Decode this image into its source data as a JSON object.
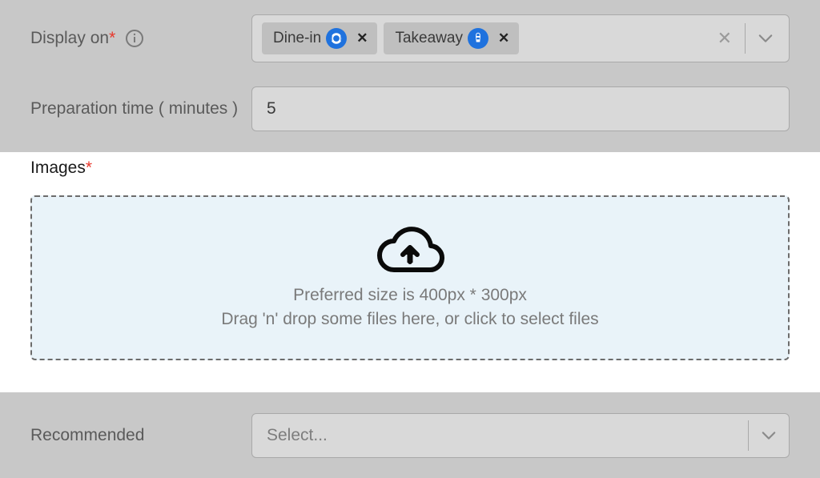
{
  "display_on": {
    "label": "Display on",
    "required_marker": "*",
    "tags": [
      {
        "label": "Dine-in",
        "icon": "dinein"
      },
      {
        "label": "Takeaway",
        "icon": "takeaway"
      }
    ]
  },
  "prep_time": {
    "label": "Preparation time ( minutes )",
    "value": "5"
  },
  "images": {
    "label": "Images",
    "required_marker": "*",
    "hint1": "Preferred size is 400px * 300px",
    "hint2": "Drag 'n' drop some files here, or click to select files"
  },
  "recommended": {
    "label": "Recommended",
    "placeholder": "Select..."
  }
}
